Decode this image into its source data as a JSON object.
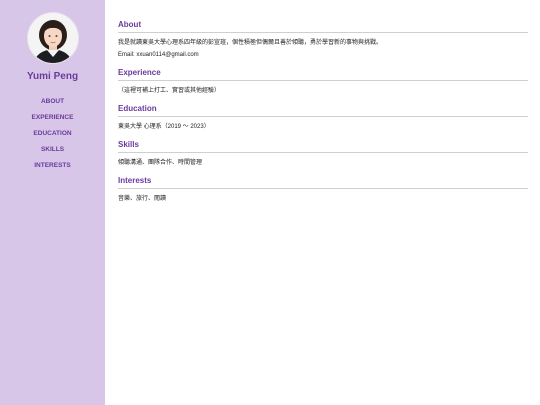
{
  "profile": {
    "name": "Yumi Peng"
  },
  "nav": {
    "about": "ABOUT",
    "experience": "EXPERIENCE",
    "education": "EDUCATION",
    "skills": "SKILLS",
    "interests": "INTERESTS"
  },
  "sections": {
    "about": {
      "title": "About",
      "text": "我是就讀東吳大學心理系四年級的彭宣瑄，個性積極但偶爾且善於傾聽，勇於學習新的事物與挑戰。",
      "email": "Email: xxuan0114@gmail.com"
    },
    "experience": {
      "title": "Experience",
      "text": "（這裡可補上打工、實習或其他經驗）"
    },
    "education": {
      "title": "Education",
      "text": "東吳大學 心理系（2019 ～ 2023）"
    },
    "skills": {
      "title": "Skills",
      "text": "傾聽溝通、團隊合作、時間管理"
    },
    "interests": {
      "title": "Interests",
      "text": "音樂、旅行、閱讀"
    }
  },
  "colors": {
    "sidebar": "#d8c6e8",
    "accent": "#6a3a9c"
  }
}
